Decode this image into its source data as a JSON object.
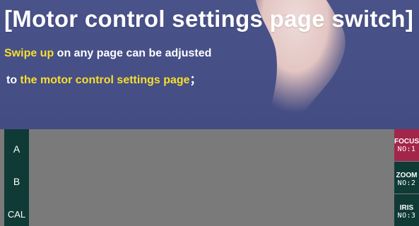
{
  "banner": {
    "title": "[Motor control settings page switch]",
    "line1_highlight": "Swipe up",
    "line1_rest": " on any page can be adjusted",
    "line2_prefix": " to ",
    "line2_highlight": "the motor control settings page",
    "line2_suffix": "；",
    "highlight_color": "#f7df2d"
  },
  "panel": {
    "left_buttons": [
      {
        "label": "A"
      },
      {
        "label": "B"
      },
      {
        "label": "CAL"
      }
    ],
    "right_buttons": [
      {
        "name": "FOCUS",
        "num": "NO:1",
        "color": "#a3254a"
      },
      {
        "name": "ZOOM",
        "num": "NO:2",
        "color": "#0f3a36"
      },
      {
        "name": "IRIS",
        "num": "NO:3",
        "color": "#0f3a36"
      }
    ]
  }
}
